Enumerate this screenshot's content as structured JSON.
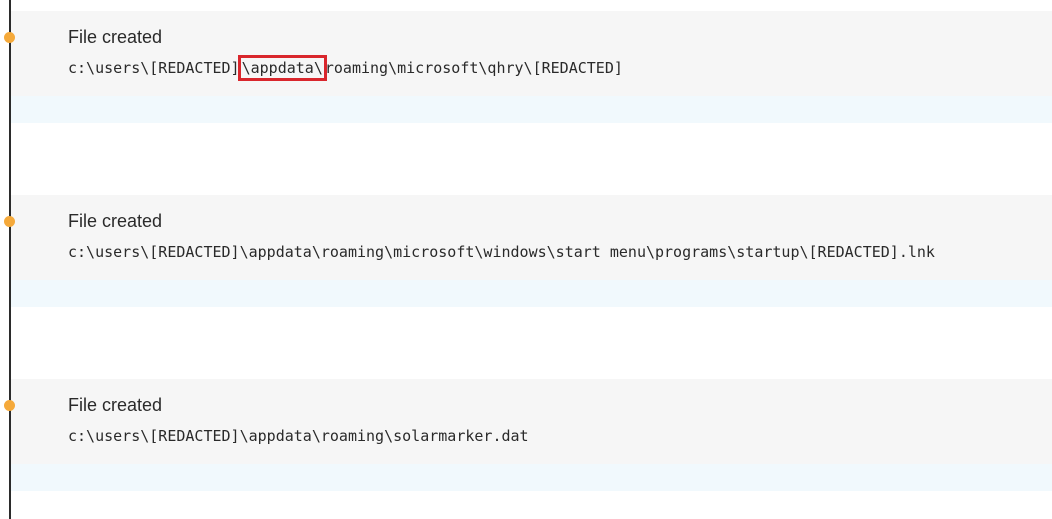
{
  "events": [
    {
      "title": "File created",
      "path_before": "c:\\users\\[REDACTED]",
      "path_highlight": "\\appdata\\",
      "path_after": "roaming\\microsoft\\qhry\\[REDACTED]"
    },
    {
      "title": "File created",
      "path": "c:\\users\\[REDACTED]\\appdata\\roaming\\microsoft\\windows\\start menu\\programs\\startup\\[REDACTED].lnk"
    },
    {
      "title": "File created",
      "path": "c:\\users\\[REDACTED]\\appdata\\roaming\\solarmarker.dat"
    }
  ],
  "colors": {
    "dot": "#f5a93a",
    "highlight_border": "#d9262c",
    "card_bg": "#f6f6f6",
    "strip_bg": "#f1f9fd"
  }
}
